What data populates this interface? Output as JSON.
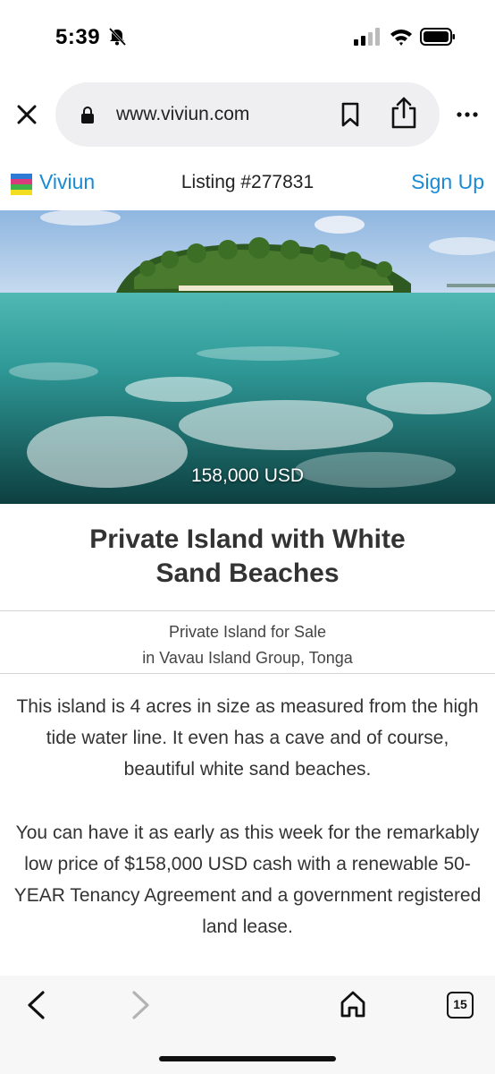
{
  "status": {
    "time": "5:39",
    "icons": [
      "bell-slash-icon",
      "signal-icon",
      "wifi-icon",
      "battery-icon"
    ]
  },
  "browser": {
    "url": "www.viviun.com",
    "icons": [
      "close-icon",
      "lock-icon",
      "bookmark-icon",
      "share-icon",
      "more-icon"
    ]
  },
  "site": {
    "brand": "Viviun",
    "listing_title": "Listing #277831",
    "signup": "Sign Up",
    "accent_color": "#1a8ad4"
  },
  "listing": {
    "price": "158,000 USD",
    "headline": "Private Island with White Sand Beaches",
    "subtitle_line1": "Private Island for Sale",
    "subtitle_line2": "in Vavau Island Group, Tonga",
    "paragraph1": "This island is 4 acres in size as measured from the high tide water line. It even has a cave and of course, beautiful white sand beaches.",
    "paragraph2": "You can have it as early as this week for the remarkably low price of $158,000 USD cash with a renewable 50-YEAR Tenancy Agreement and a government registered land lease."
  },
  "toolbar": {
    "tab_count": "15",
    "icons": [
      "back-icon",
      "forward-icon",
      "home-icon",
      "tabs-icon"
    ]
  }
}
